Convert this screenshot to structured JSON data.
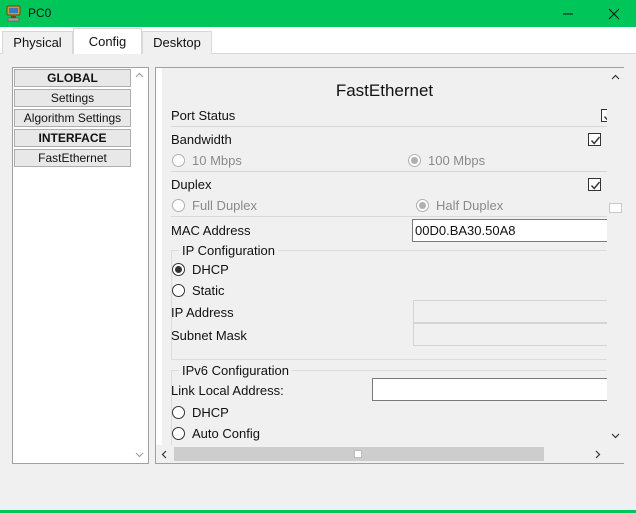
{
  "window": {
    "title": "PC0",
    "accent_color": "#00c65a",
    "icon": "pc-device-icon",
    "controls": [
      "minimize-icon",
      "maximize-icon",
      "close-icon"
    ]
  },
  "tabs": [
    {
      "label": "Physical",
      "active": false
    },
    {
      "label": "Config",
      "active": true
    },
    {
      "label": "Desktop",
      "active": false
    }
  ],
  "sidebar": {
    "items": [
      {
        "label": "GLOBAL",
        "header": true
      },
      {
        "label": "Settings",
        "header": false
      },
      {
        "label": "Algorithm Settings",
        "header": false
      },
      {
        "label": "INTERFACE",
        "header": true
      },
      {
        "label": "FastEthernet",
        "header": false
      }
    ]
  },
  "interface": {
    "heading": "FastEthernet",
    "port_status": {
      "label": "Port Status",
      "checked": true
    },
    "bandwidth": {
      "label": "Bandwidth",
      "auto_checked": true,
      "option_10": "10 Mbps",
      "option_100": "100 Mbps",
      "selected": "100 Mbps"
    },
    "duplex": {
      "label": "Duplex",
      "auto_checked": true,
      "option_full": "Full Duplex",
      "option_half": "Half Duplex",
      "selected": "Half Duplex"
    },
    "mac": {
      "label": "MAC Address",
      "value": "00D0.BA30.50A8"
    },
    "ip_config": {
      "legend": "IP Configuration",
      "dhcp_label": "DHCP",
      "static_label": "Static",
      "selected": "DHCP",
      "ip_address_label": "IP Address",
      "ip_address_value": "",
      "subnet_mask_label": "Subnet Mask",
      "subnet_mask_value": ""
    },
    "ipv6_config": {
      "legend": "IPv6 Configuration",
      "link_local_label": "Link Local Address:",
      "link_local_value": "",
      "dhcp_label": "DHCP",
      "auto_config_label": "Auto Config"
    }
  }
}
